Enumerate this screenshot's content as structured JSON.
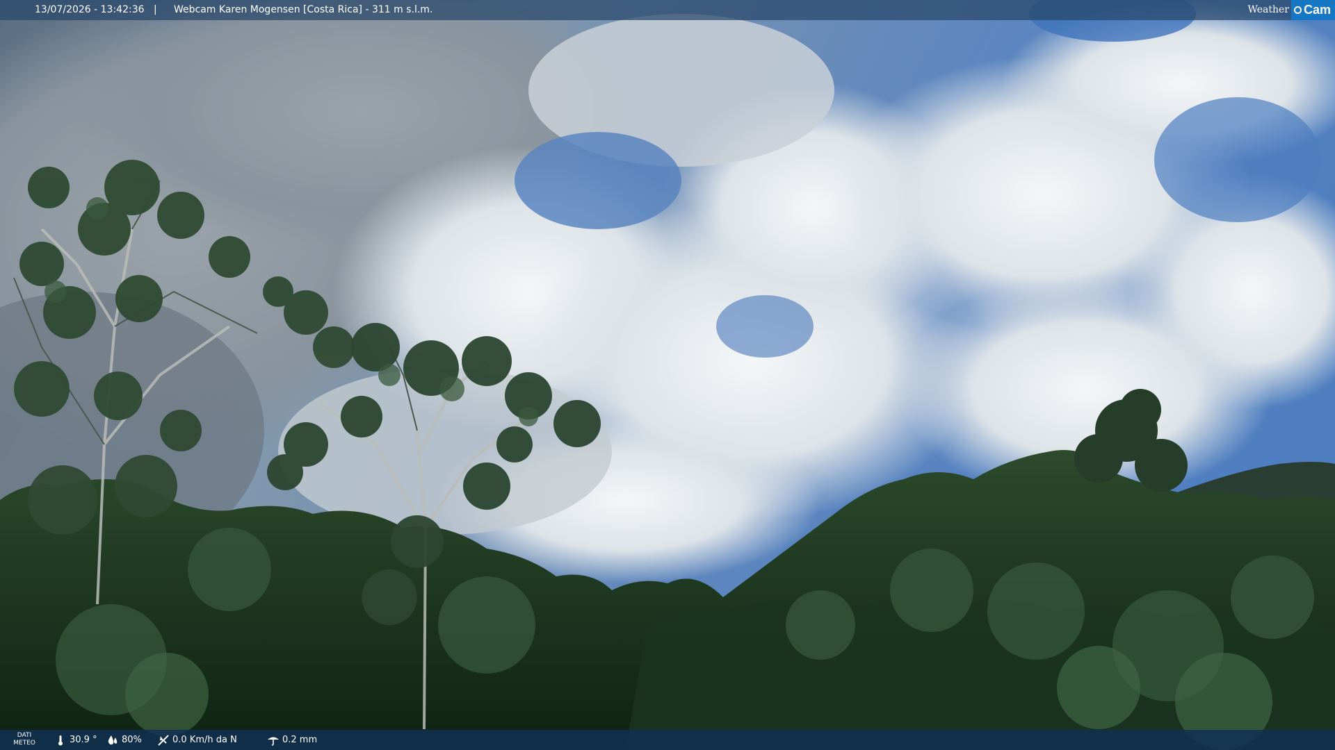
{
  "overlay": {
    "timestamp": "13/07/2026 - 13:42:36",
    "separator": "|",
    "title": "Webcam Karen Mogensen [Costa Rica] - 311 m s.l.m."
  },
  "logo": {
    "word": "Weather",
    "cam": "Cam"
  },
  "weather": {
    "label_line1": "DATI",
    "label_line2": "METEO",
    "temperature": "30.9 °",
    "humidity": "80%",
    "wind": "0.0 Km/h da N",
    "rain": "0.2 mm"
  },
  "colors": {
    "sky": "#6b8fb8",
    "cloud": "#e8ecef",
    "forest": "#1f3a20",
    "bar": "#123052",
    "logo_accent": "#1677c4"
  },
  "icons": {
    "temperature": "thermometer-icon",
    "humidity": "humidity-drop-icon",
    "wind": "wind-icon",
    "rain": "rain-gauge-icon"
  }
}
